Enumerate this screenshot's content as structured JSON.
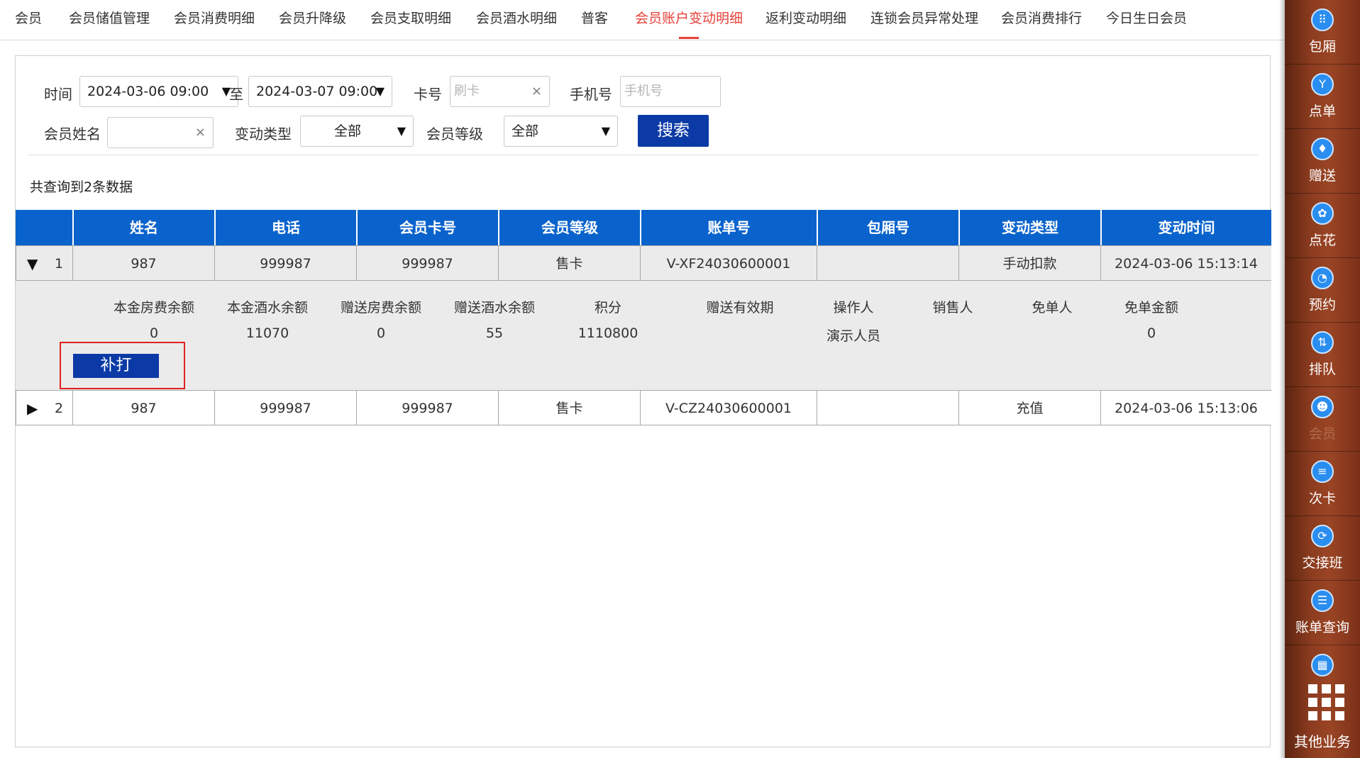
{
  "tabs": [
    {
      "label": "会员",
      "active": false
    },
    {
      "label": "会员储值管理",
      "active": false
    },
    {
      "label": "会员消费明细",
      "active": false
    },
    {
      "label": "会员升降级",
      "active": false
    },
    {
      "label": "会员支取明细",
      "active": false
    },
    {
      "label": "会员酒水明细",
      "active": false
    },
    {
      "label": "普客",
      "active": false
    },
    {
      "label": "会员账户变动明细",
      "active": true
    },
    {
      "label": "返利变动明细",
      "active": false
    },
    {
      "label": "连锁会员异常处理",
      "active": false
    },
    {
      "label": "会员消费排行",
      "active": false
    },
    {
      "label": "今日生日会员",
      "active": false
    }
  ],
  "filters": {
    "time_label": "时间",
    "start": "2024-03-06 09:00",
    "to_label": "至",
    "end": "2024-03-07 09:00",
    "card_label": "卡号",
    "card_placeholder": "刷卡",
    "phone_label": "手机号",
    "phone_placeholder": "手机号",
    "name_label": "会员姓名",
    "name_value": "",
    "change_type_label": "变动类型",
    "change_type_value": "全部",
    "level_label": "会员等级",
    "level_value": "全部",
    "search_label": "搜索",
    "clear_glyph": "×",
    "caret_glyph": "▼"
  },
  "result_count_text": "共查询到2条数据",
  "table": {
    "columns": [
      "姓名",
      "电话",
      "会员卡号",
      "会员等级",
      "账单号",
      "包厢号",
      "变动类型",
      "变动时间"
    ],
    "rows": [
      {
        "index": "1",
        "expanded": true,
        "arrow": "▼",
        "cells": [
          "987",
          "999987",
          "999987",
          "售卡",
          "V-XF24030600001",
          "",
          "手动扣款",
          "2024-03-06 15:13:14"
        ]
      },
      {
        "index": "2",
        "expanded": false,
        "arrow": "▶",
        "cells": [
          "987",
          "999987",
          "999987",
          "售卡",
          "V-CZ24030600001",
          "",
          "充值",
          "2024-03-06 15:13:06"
        ]
      }
    ]
  },
  "detail": {
    "headers": [
      "本金房费余额",
      "本金酒水余额",
      "赠送房费余额",
      "赠送酒水余额",
      "积分",
      "赠送有效期",
      "操作人",
      "销售人",
      "免单人",
      "免单金额"
    ],
    "values": [
      "0",
      "11070",
      "0",
      "55",
      "1110800",
      "",
      "演示人员",
      "",
      "",
      "0"
    ],
    "reprint_label": "补打"
  },
  "rail": {
    "items": [
      {
        "label": "包厢",
        "icon": "grid-dots-icon",
        "glyph": "⠿",
        "active": false
      },
      {
        "label": "点单",
        "icon": "cocktail-icon",
        "glyph": "Y",
        "active": false
      },
      {
        "label": "赠送",
        "icon": "gift-icon",
        "glyph": "♦",
        "active": false
      },
      {
        "label": "点花",
        "icon": "flower-icon",
        "glyph": "✿",
        "active": false
      },
      {
        "label": "预约",
        "icon": "reserve-icon",
        "glyph": "◔",
        "active": false
      },
      {
        "label": "排队",
        "icon": "queue-icon",
        "glyph": "⇅",
        "active": false
      },
      {
        "label": "会员",
        "icon": "member-icon",
        "glyph": "☻",
        "active": true
      },
      {
        "label": "次卡",
        "icon": "punch-card-icon",
        "glyph": "≡",
        "active": false
      },
      {
        "label": "交接班",
        "icon": "shift-handover-icon",
        "glyph": "⟳",
        "active": false
      },
      {
        "label": "账单查询",
        "icon": "bill-query-icon",
        "glyph": "☰",
        "active": false
      },
      {
        "label": "",
        "icon": "report-chart-icon",
        "glyph": "▦",
        "active": false
      }
    ],
    "more_label": "其他业务",
    "more_icon": "apps-grid-icon"
  },
  "colors": {
    "accent_red": "#e8413a",
    "header_blue": "#0a63cc",
    "button_navy": "#0b3aa6",
    "rail_brown": "#8c3c1f",
    "highlight_border": "#e02020"
  }
}
